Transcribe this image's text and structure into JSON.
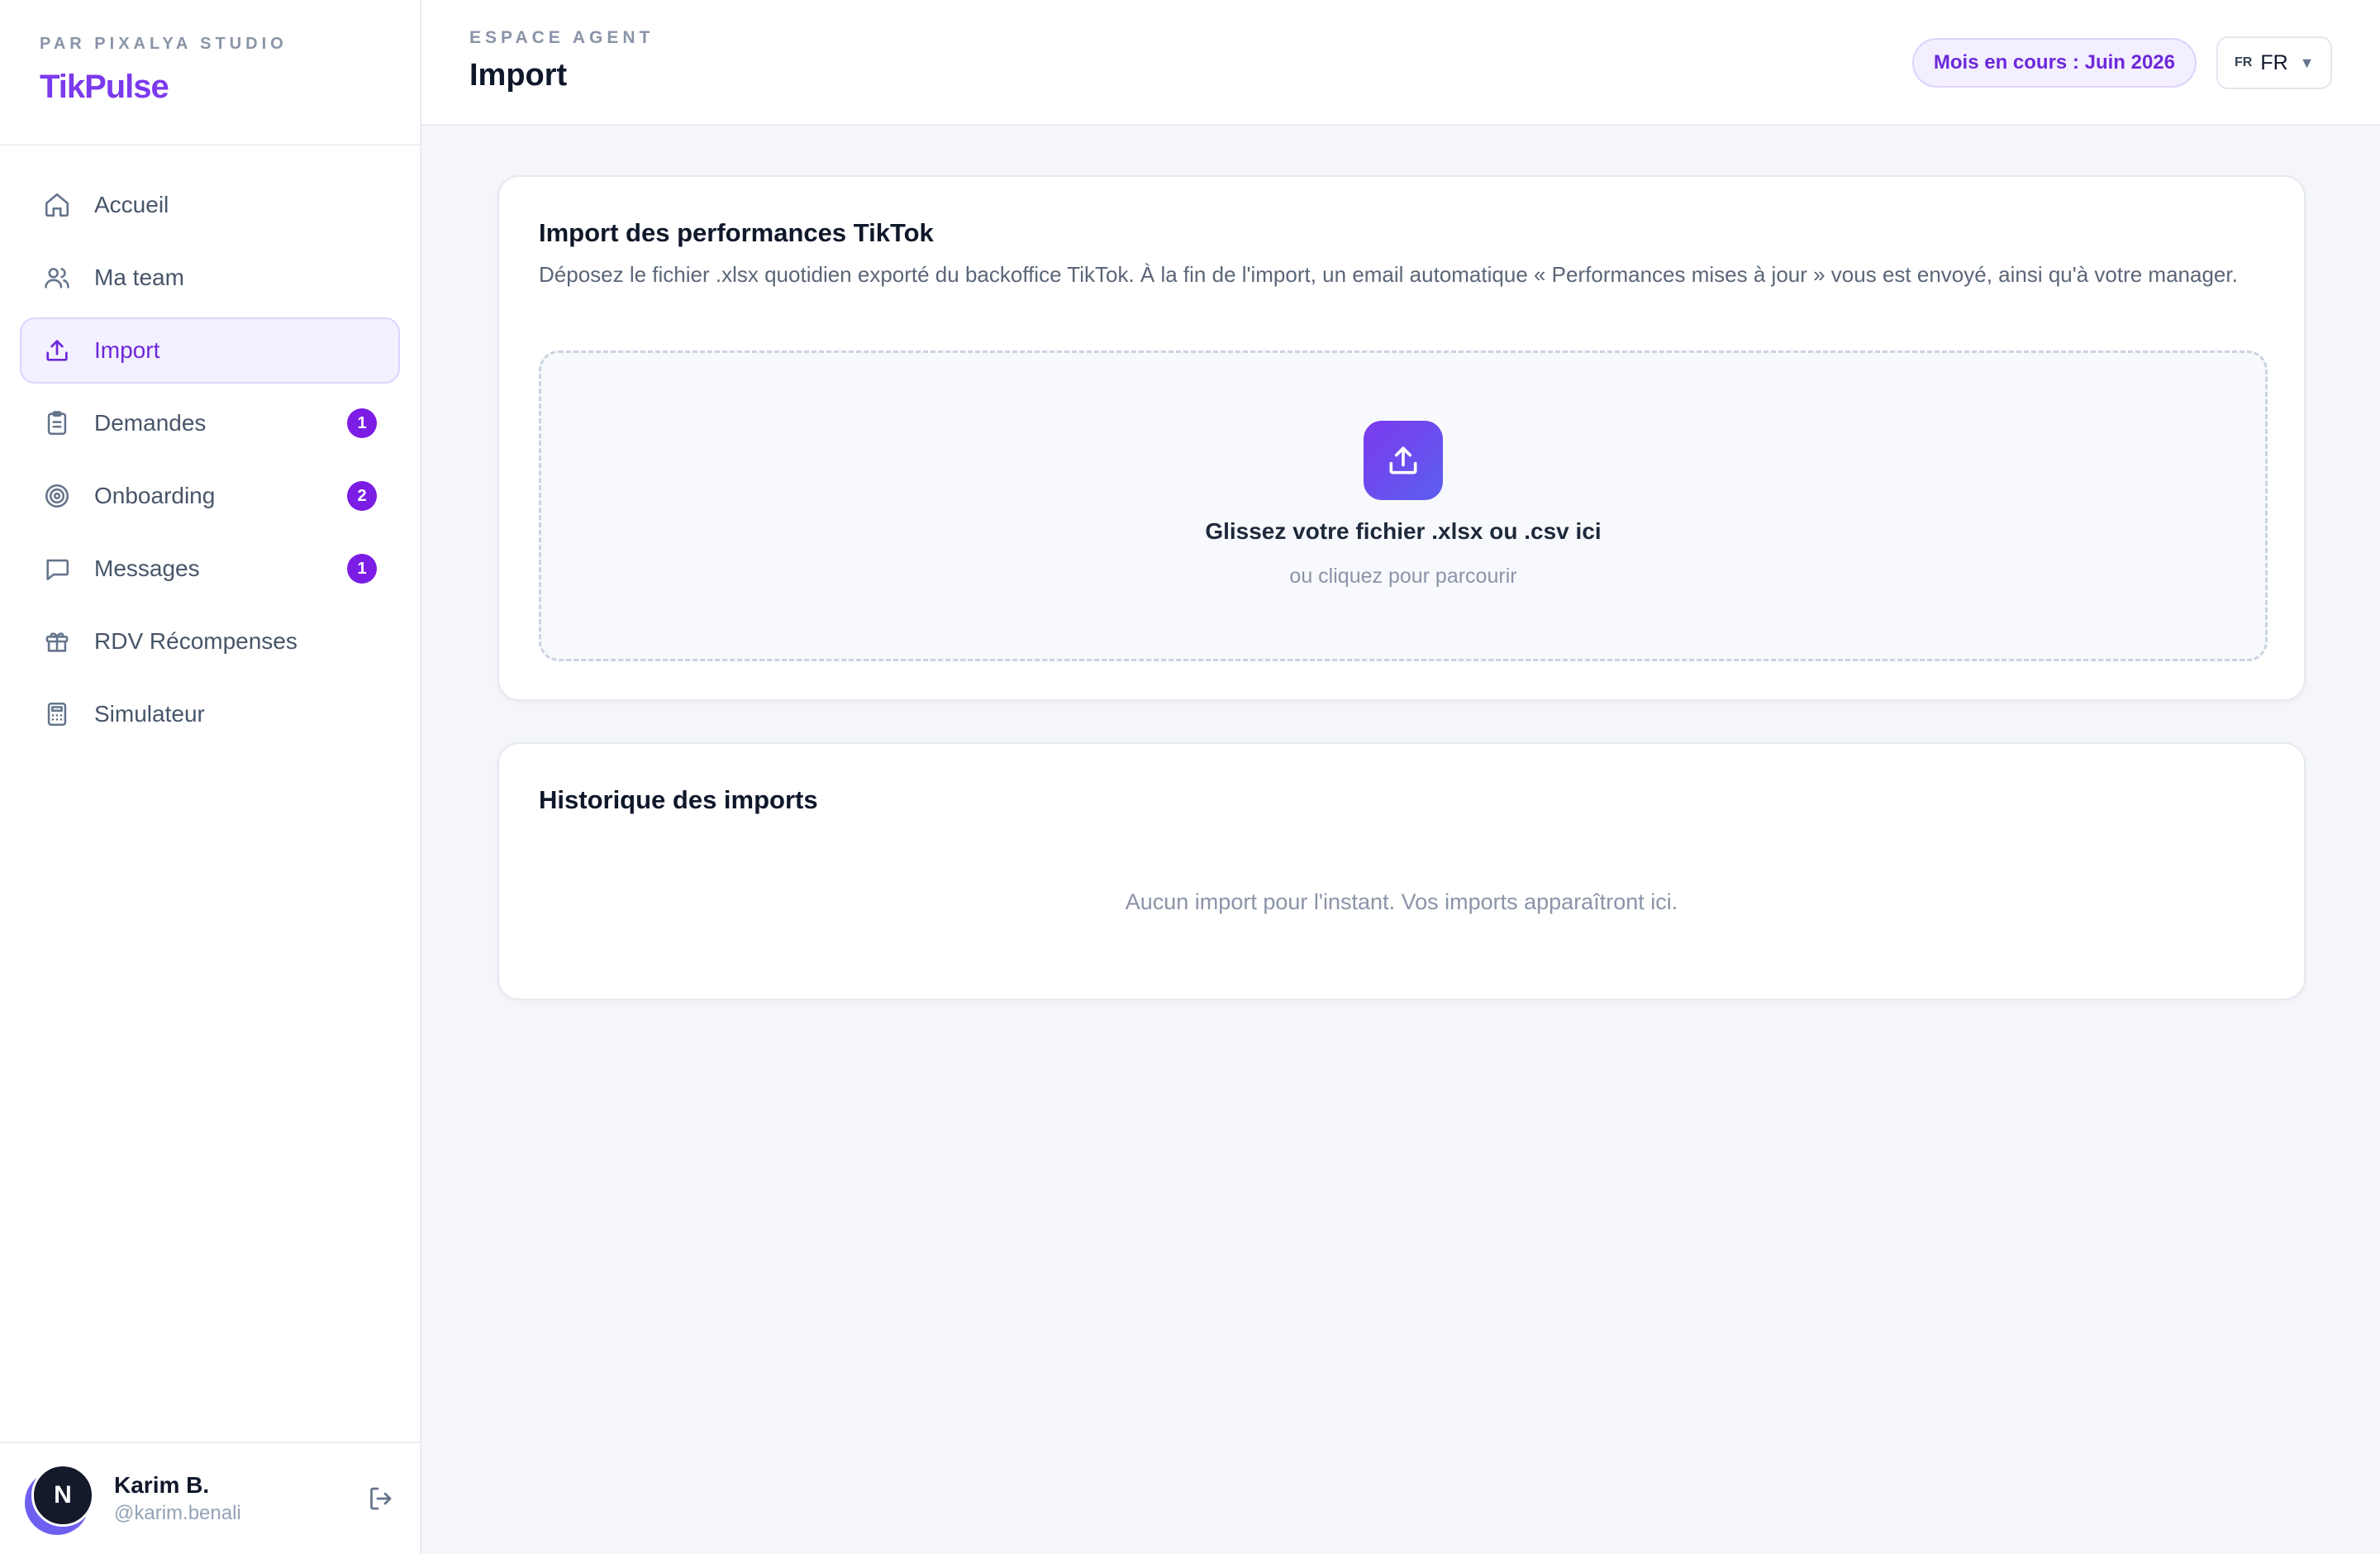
{
  "brand": {
    "tagline": "PAR PIXALYA STUDIO",
    "name": "TikPulse"
  },
  "nav": {
    "items": [
      {
        "label": "Accueil",
        "icon": "home-icon"
      },
      {
        "label": "Ma team",
        "icon": "users-icon"
      },
      {
        "label": "Import",
        "icon": "upload-icon",
        "active": true
      },
      {
        "label": "Demandes",
        "icon": "clipboard-icon",
        "badge": "1"
      },
      {
        "label": "Onboarding",
        "icon": "target-icon",
        "badge": "2"
      },
      {
        "label": "Messages",
        "icon": "message-icon",
        "badge": "1"
      },
      {
        "label": "RDV Récompenses",
        "icon": "gift-icon"
      },
      {
        "label": "Simulateur",
        "icon": "calculator-icon"
      }
    ]
  },
  "user": {
    "initial": "N",
    "name": "Karim B.",
    "handle": "@karim.benali"
  },
  "header": {
    "eyebrow": "ESPACE AGENT",
    "title": "Import",
    "month_label": "Mois en cours : Juin 2026",
    "lang_code": "FR",
    "lang_value": "FR"
  },
  "import_card": {
    "title": "Import des performances TikTok",
    "description": "Déposez le fichier .xlsx quotidien exporté du backoffice TikTok. À la fin de l'import, un email automatique « Performances mises à jour » vous est envoyé, ainsi qu'à votre manager.",
    "dropzone_title": "Glissez votre fichier .xlsx ou .csv ici",
    "dropzone_subtitle": "ou cliquez pour parcourir"
  },
  "history_card": {
    "title": "Historique des imports",
    "empty_message": "Aucun import pour l'instant. Vos imports apparaîtront ici."
  },
  "colors": {
    "accent": "#7c3aed",
    "badge": "#7c1de6",
    "background": "#f5f6fa"
  }
}
